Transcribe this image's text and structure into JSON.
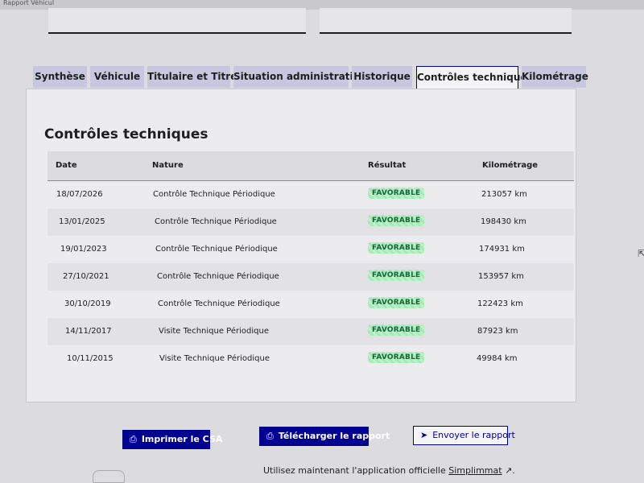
{
  "window": {
    "title": "Rapport Véhicul"
  },
  "tabs": [
    {
      "label": "Synthèse",
      "active": false
    },
    {
      "label": "Véhicule",
      "active": false
    },
    {
      "label": "Titulaire et Titre",
      "active": false
    },
    {
      "label": "Situation administrative",
      "active": false
    },
    {
      "label": "Historique",
      "active": false
    },
    {
      "label": "Contrôles techniques",
      "active": true
    },
    {
      "label": "Kilométrage",
      "active": false
    }
  ],
  "panel": {
    "title": "Contrôles techniques",
    "columns": {
      "date": "Date",
      "nature": "Nature",
      "result": "Résultat",
      "mileage": "Kilométrage"
    },
    "rows": [
      {
        "date": "18/07/2026",
        "nature": "Contrôle Technique Périodique",
        "result": "FAVORABLE",
        "mileage": "213057 km"
      },
      {
        "date": "13/01/2025",
        "nature": "Contrôle Technique Périodique",
        "result": "FAVORABLE",
        "mileage": "198430 km"
      },
      {
        "date": "19/01/2023",
        "nature": "Contrôle Technique Périodique",
        "result": "FAVORABLE",
        "mileage": "174931 km"
      },
      {
        "date": "27/10/2021",
        "nature": "Contrôle Technique Périodique",
        "result": "FAVORABLE",
        "mileage": "153957 km"
      },
      {
        "date": "30/10/2019",
        "nature": "Contrôle Technique Périodique",
        "result": "FAVORABLE",
        "mileage": "122423 km"
      },
      {
        "date": "14/11/2017",
        "nature": "Visite Technique Périodique",
        "result": "FAVORABLE",
        "mileage": "87923 km"
      },
      {
        "date": "10/11/2015",
        "nature": "Visite Technique Périodique",
        "result": "FAVORABLE",
        "mileage": "49984 km"
      }
    ]
  },
  "actions": {
    "print": "Imprimer le CSA",
    "download": "Télécharger le rapport",
    "send": "Envoyer le rapport"
  },
  "footer": {
    "text": "Utilisez maintenant l'application officielle ",
    "link": "Simplimmat"
  },
  "colors": {
    "accent": "#000091",
    "tab_inactive": "#c7c7df",
    "badge_bg": "#b8f2c6",
    "badge_text": "#17663a"
  },
  "icons": {
    "print": "printer-icon",
    "download": "download-icon",
    "send": "send-icon",
    "external": "external-link-icon"
  }
}
